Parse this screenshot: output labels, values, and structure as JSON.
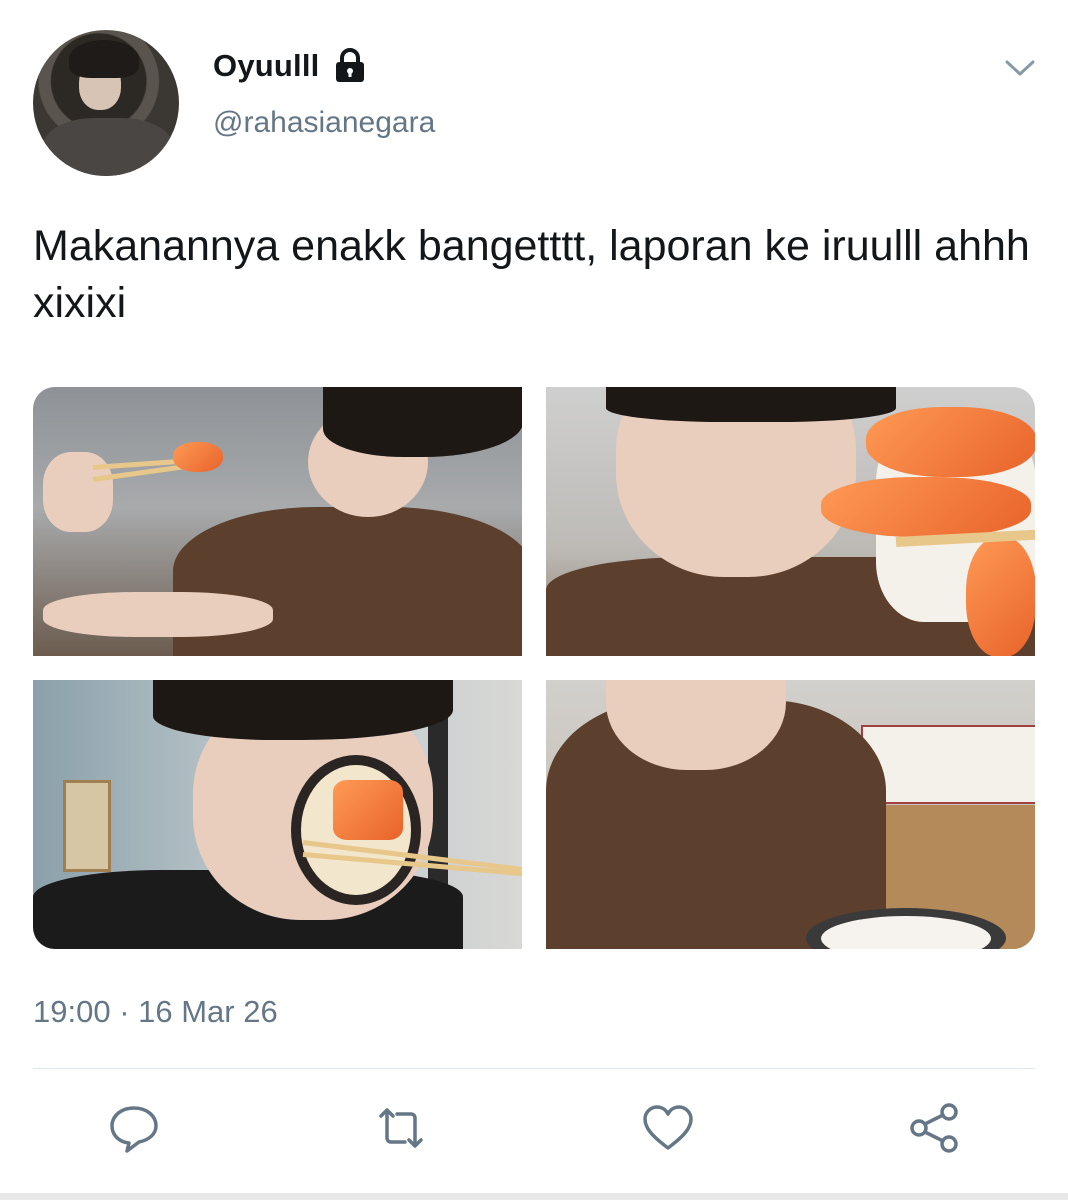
{
  "user": {
    "display_name": "Oyuulll",
    "handle": "@rahasianegara",
    "protected_icon": "lock-icon"
  },
  "tweet": {
    "text": "Makanannya enakk bangetttt, laporan ke iruulll ahhh xixixi",
    "timestamp": "19:00 · 16 Mar 26"
  },
  "media": {
    "photos": [
      {
        "id": "photo-1"
      },
      {
        "id": "photo-2"
      },
      {
        "id": "photo-3"
      },
      {
        "id": "photo-4"
      }
    ]
  },
  "actions": [
    {
      "name": "reply-icon"
    },
    {
      "name": "retweet-icon"
    },
    {
      "name": "like-icon"
    },
    {
      "name": "share-icon"
    }
  ],
  "colors": {
    "text": "#14171a",
    "secondary_text": "#657786",
    "divider": "#e1e8ed"
  }
}
